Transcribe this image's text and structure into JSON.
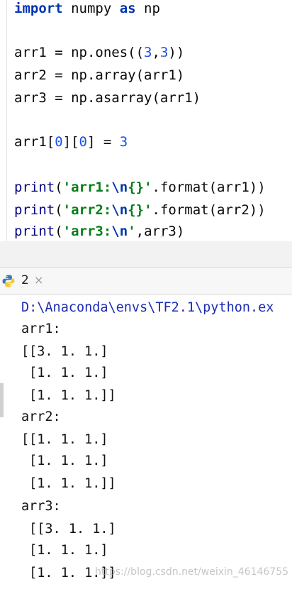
{
  "editor": {
    "lines": [
      {
        "tokens": [
          {
            "cls": "kw",
            "text": "import"
          },
          {
            "cls": "plain",
            "text": " numpy "
          },
          {
            "cls": "kw",
            "text": "as"
          },
          {
            "cls": "plain",
            "text": " np"
          }
        ]
      },
      {
        "tokens": []
      },
      {
        "tokens": [
          {
            "cls": "plain",
            "text": "arr1 = np.ones(("
          },
          {
            "cls": "num",
            "text": "3"
          },
          {
            "cls": "plain",
            "text": ","
          },
          {
            "cls": "num",
            "text": "3"
          },
          {
            "cls": "plain",
            "text": "))"
          }
        ]
      },
      {
        "tokens": [
          {
            "cls": "plain",
            "text": "arr2 = np.array(arr1)"
          }
        ]
      },
      {
        "tokens": [
          {
            "cls": "plain",
            "text": "arr3 = np.asarray(arr1)"
          }
        ]
      },
      {
        "tokens": []
      },
      {
        "tokens": [
          {
            "cls": "plain",
            "text": "arr1["
          },
          {
            "cls": "num",
            "text": "0"
          },
          {
            "cls": "plain",
            "text": "]["
          },
          {
            "cls": "num",
            "text": "0"
          },
          {
            "cls": "plain",
            "text": "] = "
          },
          {
            "cls": "num",
            "text": "3"
          }
        ]
      },
      {
        "tokens": []
      },
      {
        "tokens": [
          {
            "cls": "fn",
            "text": "print"
          },
          {
            "cls": "plain",
            "text": "("
          },
          {
            "cls": "str",
            "text": "'arr1:"
          },
          {
            "cls": "esc",
            "text": "\\n"
          },
          {
            "cls": "str",
            "text": "{}'"
          },
          {
            "cls": "plain",
            "text": ".format(arr1))"
          }
        ]
      },
      {
        "tokens": [
          {
            "cls": "fn",
            "text": "print"
          },
          {
            "cls": "plain",
            "text": "("
          },
          {
            "cls": "str",
            "text": "'arr2:"
          },
          {
            "cls": "esc",
            "text": "\\n"
          },
          {
            "cls": "str",
            "text": "{}'"
          },
          {
            "cls": "plain",
            "text": ".format(arr2))"
          }
        ]
      },
      {
        "tokens": [
          {
            "cls": "fn",
            "text": "print"
          },
          {
            "cls": "plain",
            "text": "("
          },
          {
            "cls": "str",
            "text": "'arr3:"
          },
          {
            "cls": "esc",
            "text": "\\n"
          },
          {
            "cls": "str",
            "text": "'"
          },
          {
            "cls": "plain",
            "text": ",arr3)"
          }
        ]
      }
    ]
  },
  "run_tab": {
    "label": "2",
    "close_glyph": "×",
    "icon": "python-icon"
  },
  "console": {
    "lines": [
      "D:\\Anaconda\\envs\\TF2.1\\python.ex",
      "arr1:",
      "[[3. 1. 1.]",
      " [1. 1. 1.]",
      " [1. 1. 1.]]",
      "arr2:",
      "[[1. 1. 1.]",
      " [1. 1. 1.]",
      " [1. 1. 1.]]",
      "arr3:",
      " [[3. 1. 1.]",
      " [1. 1. 1.]",
      " [1. 1. 1.]]"
    ]
  },
  "watermark": "https://blog.csdn.net/weixin_46146755",
  "colors": {
    "keyword": "#0033b3",
    "number": "#1750eb",
    "string": "#067d17",
    "console_path": "#1c2bb3"
  }
}
